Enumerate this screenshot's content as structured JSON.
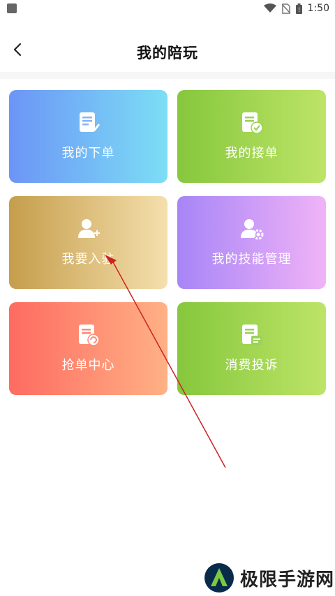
{
  "status_bar": {
    "time": "1:50"
  },
  "header": {
    "title": "我的陪玩"
  },
  "cards": [
    {
      "label": "我的下单",
      "icon": "document-icon"
    },
    {
      "label": "我的接单",
      "icon": "document-check-icon"
    },
    {
      "label": "我要入驻",
      "icon": "user-add-icon"
    },
    {
      "label": "我的技能管理",
      "icon": "user-gear-icon"
    },
    {
      "label": "抢单中心",
      "icon": "document-refresh-icon"
    },
    {
      "label": "消费投诉",
      "icon": "document-complaint-icon"
    }
  ],
  "watermark": {
    "text": "极限手游网"
  },
  "colors": {
    "annotation_arrow": "#cc2222"
  }
}
